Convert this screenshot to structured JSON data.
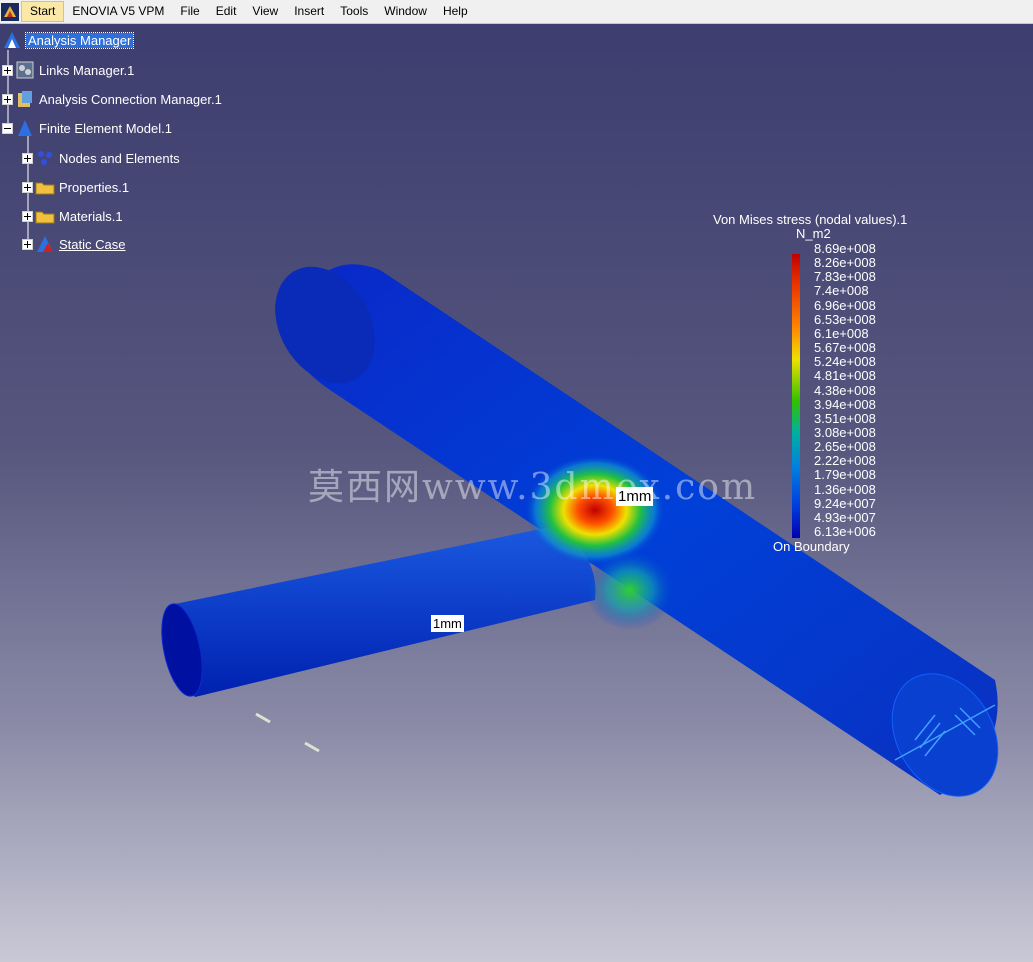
{
  "menubar": {
    "items": [
      {
        "label": "Start"
      },
      {
        "label": "ENOVIA V5 VPM"
      },
      {
        "label": "File"
      },
      {
        "label": "Edit"
      },
      {
        "label": "View"
      },
      {
        "label": "Insert"
      },
      {
        "label": "Tools"
      },
      {
        "label": "Window"
      },
      {
        "label": "Help"
      }
    ]
  },
  "tree": {
    "nodes": [
      {
        "label": "Analysis Manager",
        "icon": "analysis-manager-icon"
      },
      {
        "label": "Links Manager.1",
        "icon": "links-manager-icon"
      },
      {
        "label": "Analysis Connection Manager.1",
        "icon": "connection-manager-icon"
      },
      {
        "label": "Finite Element Model.1",
        "icon": "fem-icon"
      },
      {
        "label": "Nodes and Elements",
        "icon": "nodes-icon"
      },
      {
        "label": "Properties.1",
        "icon": "folder-icon"
      },
      {
        "label": "Materials.1",
        "icon": "folder-icon"
      },
      {
        "label": "Static Case",
        "icon": "static-case-icon"
      }
    ]
  },
  "legend": {
    "title": "Von Mises stress (nodal values).1",
    "unit": "N_m2",
    "ticks": [
      "8.69e+008",
      "8.26e+008",
      "7.83e+008",
      "7.4e+008",
      "6.96e+008",
      "6.53e+008",
      "6.1e+008",
      "5.67e+008",
      "5.24e+008",
      "4.81e+008",
      "4.38e+008",
      "3.94e+008",
      "3.51e+008",
      "3.08e+008",
      "2.65e+008",
      "2.22e+008",
      "1.79e+008",
      "1.36e+008",
      "9.24e+007",
      "4.93e+007",
      "6.13e+006"
    ],
    "footer": "On Boundary"
  },
  "dimensions": {
    "label_1": "1mm",
    "label_2": "1mm"
  },
  "watermark": "莫西网www.3dmox.com",
  "colors": {
    "background_top": "#3d3d6f",
    "background_bottom": "#c9c9d6",
    "low_stress": "#0010c0",
    "high_stress": "#c00000"
  }
}
